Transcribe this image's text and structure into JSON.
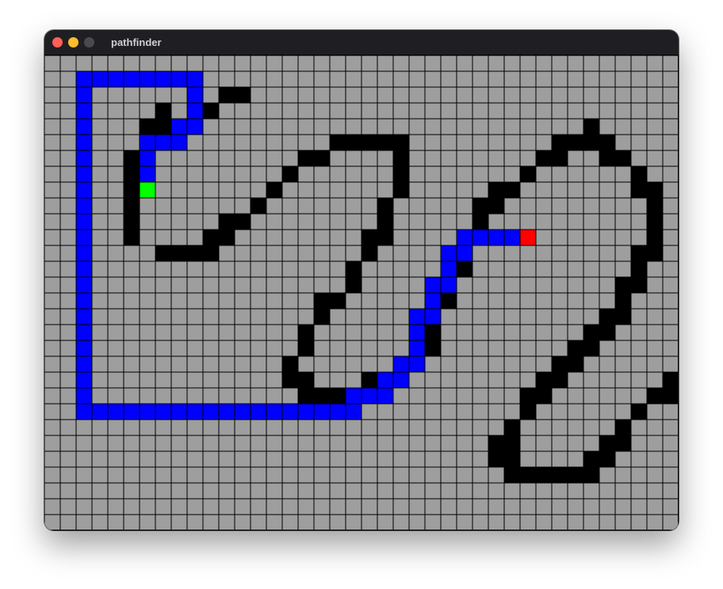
{
  "window": {
    "title": "pathfinder"
  },
  "grid": {
    "cols": 40,
    "rows": 30,
    "colors": {
      "empty": "#9e9e9e",
      "wall": "#000000",
      "path": "#0000ff",
      "start": "#00ff00",
      "end": "#ff0000",
      "gridline": "#000000"
    },
    "start": [
      6,
      8
    ],
    "end": [
      30,
      11
    ],
    "walls": [
      [
        5,
        6
      ],
      [
        5,
        7
      ],
      [
        5,
        8
      ],
      [
        5,
        9
      ],
      [
        5,
        10
      ],
      [
        5,
        11
      ],
      [
        6,
        4
      ],
      [
        7,
        4
      ],
      [
        6,
        5
      ],
      [
        8,
        4
      ],
      [
        7,
        3
      ],
      [
        9,
        3
      ],
      [
        10,
        3
      ],
      [
        11,
        2
      ],
      [
        12,
        2
      ],
      [
        9,
        12
      ],
      [
        8,
        12
      ],
      [
        7,
        12
      ],
      [
        10,
        12
      ],
      [
        10,
        11
      ],
      [
        11,
        11
      ],
      [
        11,
        10
      ],
      [
        12,
        10
      ],
      [
        13,
        9
      ],
      [
        14,
        8
      ],
      [
        15,
        7
      ],
      [
        16,
        6
      ],
      [
        17,
        6
      ],
      [
        18,
        5
      ],
      [
        19,
        5
      ],
      [
        20,
        5
      ],
      [
        21,
        5
      ],
      [
        22,
        5
      ],
      [
        22,
        6
      ],
      [
        22,
        7
      ],
      [
        22,
        8
      ],
      [
        21,
        9
      ],
      [
        21,
        10
      ],
      [
        21,
        11
      ],
      [
        20,
        11
      ],
      [
        20,
        12
      ],
      [
        19,
        13
      ],
      [
        19,
        14
      ],
      [
        18,
        15
      ],
      [
        17,
        15
      ],
      [
        17,
        16
      ],
      [
        16,
        17
      ],
      [
        16,
        18
      ],
      [
        15,
        19
      ],
      [
        15,
        20
      ],
      [
        16,
        20
      ],
      [
        16,
        21
      ],
      [
        17,
        21
      ],
      [
        18,
        21
      ],
      [
        19,
        21
      ],
      [
        20,
        20
      ],
      [
        21,
        20
      ],
      [
        22,
        20
      ],
      [
        22,
        19
      ],
      [
        23,
        19
      ],
      [
        23,
        18
      ],
      [
        24,
        18
      ],
      [
        24,
        17
      ],
      [
        24,
        16
      ],
      [
        25,
        15
      ],
      [
        25,
        14
      ],
      [
        25,
        13
      ],
      [
        26,
        13
      ],
      [
        26,
        12
      ],
      [
        27,
        11
      ],
      [
        27,
        10
      ],
      [
        27,
        9
      ],
      [
        28,
        9
      ],
      [
        28,
        8
      ],
      [
        29,
        8
      ],
      [
        30,
        7
      ],
      [
        31,
        6
      ],
      [
        32,
        6
      ],
      [
        32,
        5
      ],
      [
        33,
        5
      ],
      [
        34,
        5
      ],
      [
        35,
        5
      ],
      [
        34,
        4
      ],
      [
        35,
        6
      ],
      [
        36,
        6
      ],
      [
        37,
        7
      ],
      [
        37,
        8
      ],
      [
        38,
        8
      ],
      [
        38,
        9
      ],
      [
        38,
        10
      ],
      [
        38,
        11
      ],
      [
        38,
        12
      ],
      [
        37,
        12
      ],
      [
        37,
        13
      ],
      [
        37,
        14
      ],
      [
        36,
        14
      ],
      [
        36,
        15
      ],
      [
        36,
        16
      ],
      [
        35,
        16
      ],
      [
        35,
        17
      ],
      [
        34,
        17
      ],
      [
        34,
        18
      ],
      [
        33,
        18
      ],
      [
        33,
        19
      ],
      [
        32,
        19
      ],
      [
        32,
        20
      ],
      [
        31,
        20
      ],
      [
        31,
        21
      ],
      [
        30,
        21
      ],
      [
        30,
        22
      ],
      [
        29,
        23
      ],
      [
        29,
        24
      ],
      [
        28,
        24
      ],
      [
        28,
        25
      ],
      [
        29,
        25
      ],
      [
        29,
        26
      ],
      [
        30,
        26
      ],
      [
        31,
        26
      ],
      [
        32,
        26
      ],
      [
        33,
        26
      ],
      [
        34,
        26
      ],
      [
        34,
        25
      ],
      [
        35,
        25
      ],
      [
        35,
        24
      ],
      [
        36,
        24
      ],
      [
        36,
        23
      ],
      [
        37,
        22
      ],
      [
        38,
        21
      ],
      [
        39,
        21
      ],
      [
        39,
        20
      ]
    ],
    "path": [
      [
        6,
        7
      ],
      [
        6,
        6
      ],
      [
        6,
        5
      ],
      [
        7,
        5
      ],
      [
        8,
        5
      ],
      [
        8,
        4
      ],
      [
        9,
        4
      ],
      [
        9,
        3
      ],
      [
        9,
        2
      ],
      [
        9,
        1
      ],
      [
        8,
        1
      ],
      [
        7,
        1
      ],
      [
        6,
        1
      ],
      [
        5,
        1
      ],
      [
        4,
        1
      ],
      [
        3,
        1
      ],
      [
        2,
        1
      ],
      [
        2,
        2
      ],
      [
        2,
        3
      ],
      [
        2,
        4
      ],
      [
        2,
        5
      ],
      [
        2,
        6
      ],
      [
        2,
        7
      ],
      [
        2,
        8
      ],
      [
        2,
        9
      ],
      [
        2,
        10
      ],
      [
        2,
        11
      ],
      [
        2,
        12
      ],
      [
        2,
        13
      ],
      [
        2,
        14
      ],
      [
        2,
        15
      ],
      [
        2,
        16
      ],
      [
        2,
        17
      ],
      [
        2,
        18
      ],
      [
        2,
        19
      ],
      [
        2,
        20
      ],
      [
        2,
        21
      ],
      [
        2,
        22
      ],
      [
        3,
        22
      ],
      [
        4,
        22
      ],
      [
        5,
        22
      ],
      [
        6,
        22
      ],
      [
        7,
        22
      ],
      [
        8,
        22
      ],
      [
        9,
        22
      ],
      [
        10,
        22
      ],
      [
        11,
        22
      ],
      [
        12,
        22
      ],
      [
        13,
        22
      ],
      [
        14,
        22
      ],
      [
        15,
        22
      ],
      [
        16,
        22
      ],
      [
        17,
        22
      ],
      [
        18,
        22
      ],
      [
        19,
        22
      ],
      [
        19,
        21
      ],
      [
        20,
        21
      ],
      [
        21,
        21
      ],
      [
        21,
        20
      ],
      [
        22,
        20
      ],
      [
        22,
        19
      ],
      [
        23,
        19
      ],
      [
        23,
        18
      ],
      [
        23,
        17
      ],
      [
        23,
        16
      ],
      [
        24,
        16
      ],
      [
        24,
        15
      ],
      [
        24,
        14
      ],
      [
        25,
        14
      ],
      [
        25,
        13
      ],
      [
        25,
        12
      ],
      [
        26,
        12
      ],
      [
        26,
        11
      ],
      [
        27,
        11
      ],
      [
        28,
        11
      ],
      [
        29,
        11
      ]
    ]
  }
}
